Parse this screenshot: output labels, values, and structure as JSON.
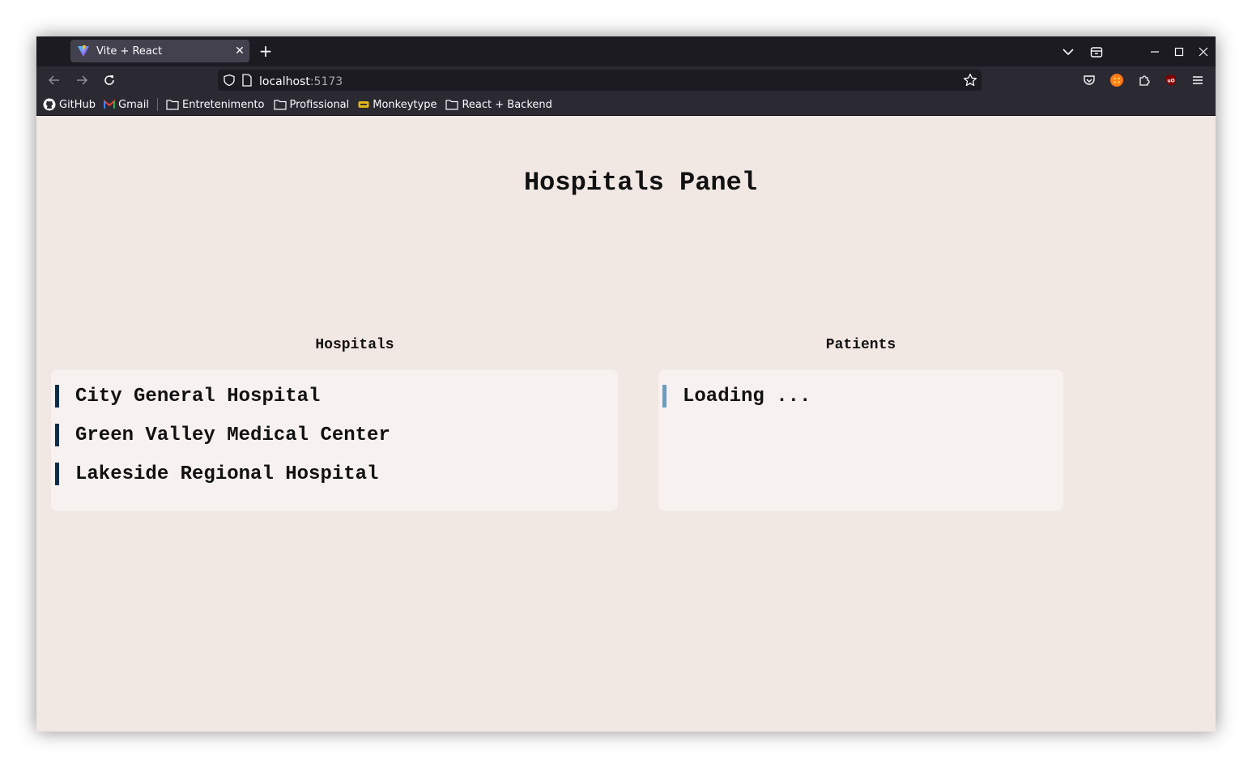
{
  "browser": {
    "tab_title": "Vite + React",
    "url_host": "localhost",
    "url_port": ":5173",
    "bookmarks": [
      {
        "label": "GitHub",
        "icon": "github-icon"
      },
      {
        "label": "Gmail",
        "icon": "gmail-icon"
      },
      {
        "label": "Entretenimento",
        "icon": "folder-icon"
      },
      {
        "label": "Profissional",
        "icon": "folder-icon"
      },
      {
        "label": "Monkeytype",
        "icon": "monkeytype-icon"
      },
      {
        "label": "React + Backend",
        "icon": "folder-icon"
      }
    ]
  },
  "page": {
    "title": "Hospitals Panel",
    "hospitals": {
      "heading": "Hospitals",
      "items": [
        "City General Hospital",
        "Green Valley Medical Center",
        "Lakeside Regional Hospital"
      ]
    },
    "patients": {
      "heading": "Patients",
      "status": "Loading ..."
    }
  },
  "colors": {
    "page_background": "#f1e7e3",
    "panel_background": "#f7f1ef",
    "item_accent": "#0d2c4a",
    "loading_accent": "#6a9cc0"
  }
}
